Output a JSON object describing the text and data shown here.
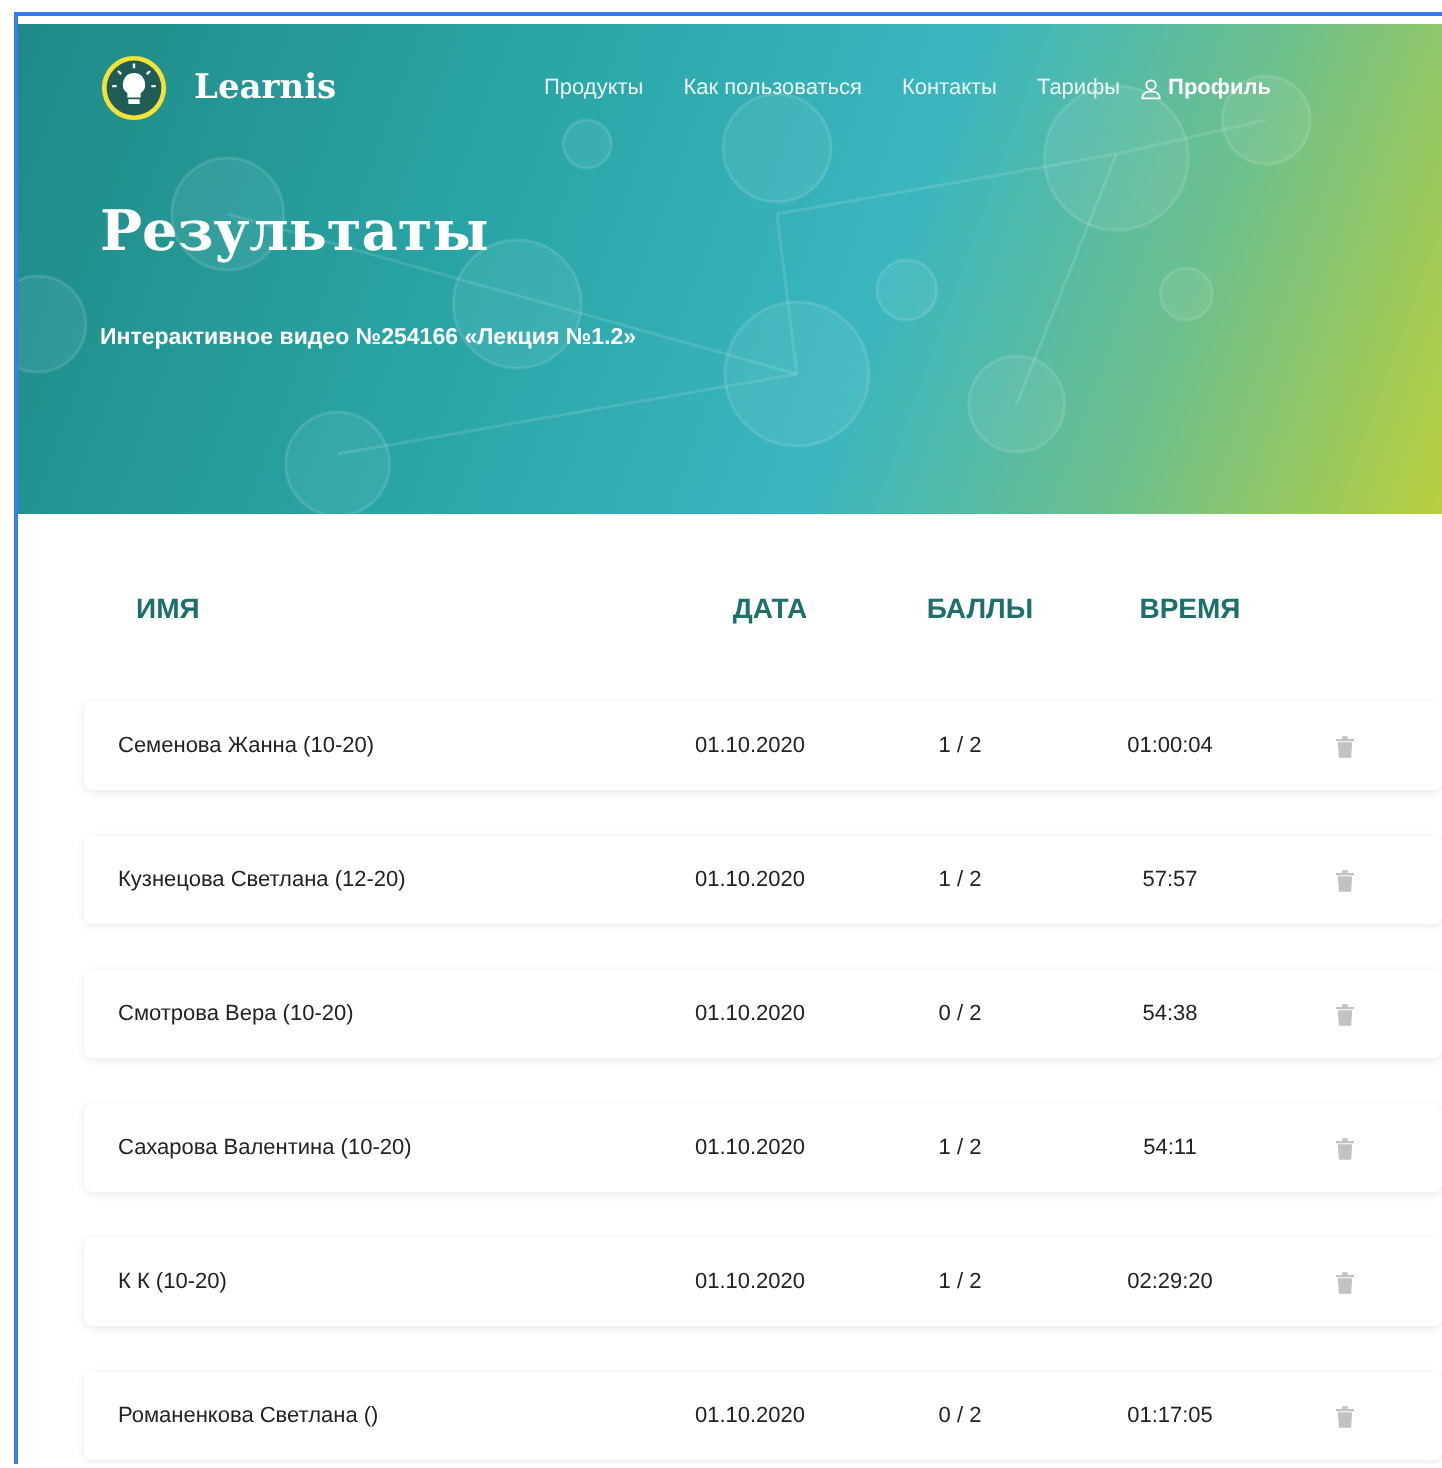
{
  "brand": {
    "name": "Learnis"
  },
  "nav": [
    {
      "label": "Продукты",
      "kind": "link"
    },
    {
      "label": "Как пользоваться",
      "kind": "link"
    },
    {
      "label": "Контакты",
      "kind": "link"
    },
    {
      "label": "Тарифы",
      "kind": "link"
    },
    {
      "label": "Профиль",
      "kind": "profile"
    }
  ],
  "hero": {
    "title": "Результаты",
    "subtitle": "Интерактивное видео №254166 «Лекция №1.2»"
  },
  "table": {
    "columns": [
      "ИМЯ",
      "ДАТА",
      "БАЛЛЫ",
      "ВРЕМЯ"
    ],
    "rows": [
      {
        "name": "Семенова Жанна (10-20)",
        "date": "01.10.2020",
        "score": "1 / 2",
        "time": "01:00:04"
      },
      {
        "name": "Кузнецова Светлана (12-20)",
        "date": "01.10.2020",
        "score": "1 / 2",
        "time": "57:57"
      },
      {
        "name": "Смотрова Вера (10-20)",
        "date": "01.10.2020",
        "score": "0 / 2",
        "time": "54:38"
      },
      {
        "name": "Сахарова Валентина (10-20)",
        "date": "01.10.2020",
        "score": "1 / 2",
        "time": "54:11"
      },
      {
        "name": "К К (10-20)",
        "date": "01.10.2020",
        "score": "1 / 2",
        "time": "02:29:20"
      },
      {
        "name": "Романенкова Светлана ()",
        "date": "01.10.2020",
        "score": "0 / 2",
        "time": "01:17:05"
      }
    ]
  }
}
